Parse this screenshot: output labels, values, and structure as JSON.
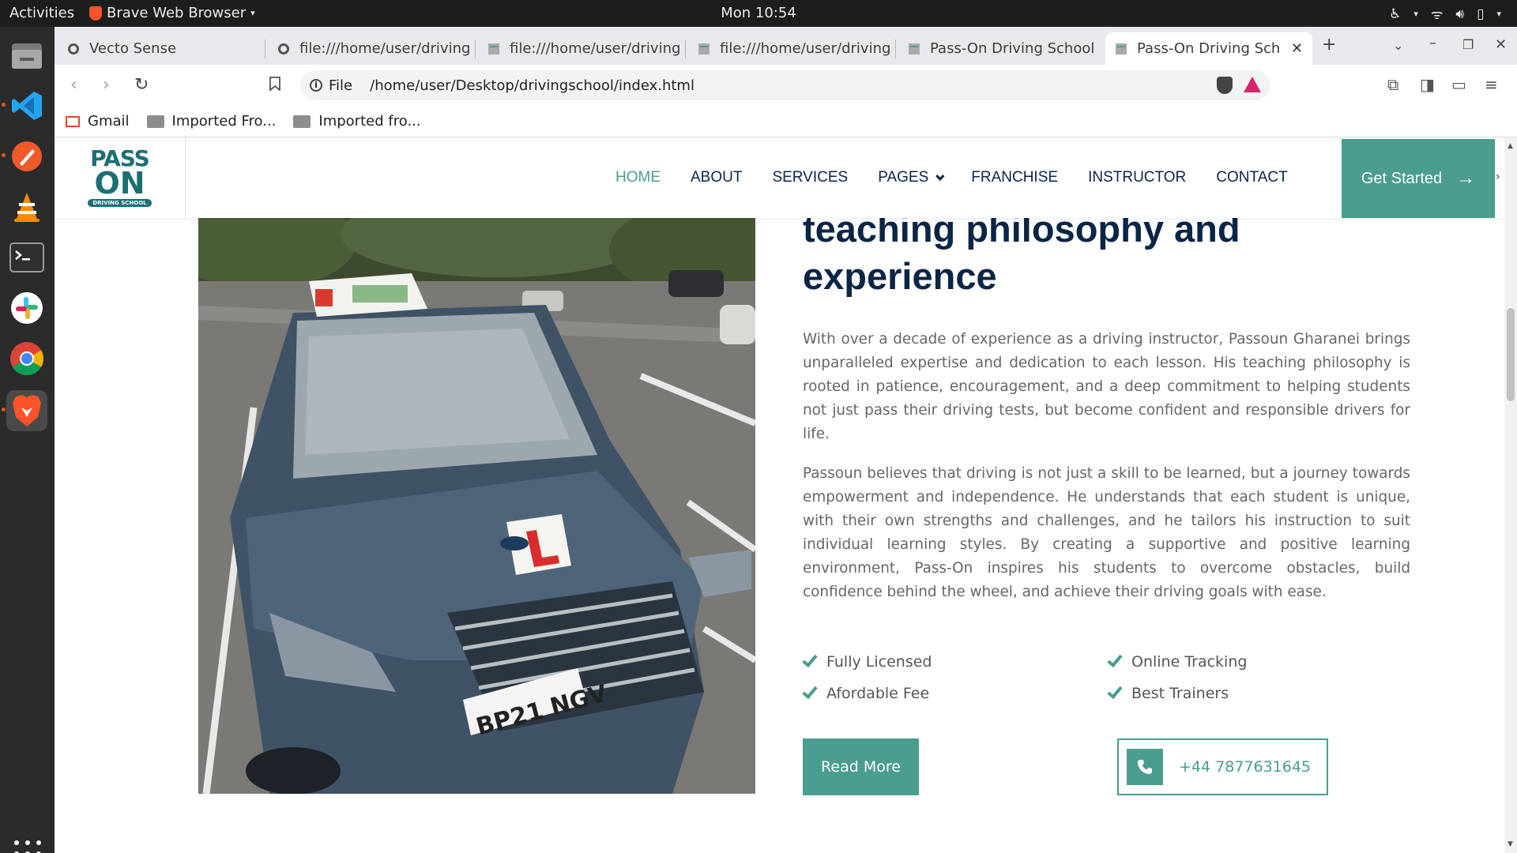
{
  "os": {
    "activities_label": "Activities",
    "app_menu_label": "Brave Web Browser",
    "clock": "Mon 10:54"
  },
  "browser": {
    "tabs": [
      {
        "title": "Vecto Sense"
      },
      {
        "title": "file:///home/user/driving"
      },
      {
        "title": "file:///home/user/driving"
      },
      {
        "title": "file:///home/user/driving"
      },
      {
        "title": "Pass-On Driving School"
      },
      {
        "title": "Pass-On Driving Scho"
      }
    ],
    "address": {
      "scheme_label": "File",
      "url": "/home/user/Desktop/drivingschool/index.html"
    },
    "bookmarks": [
      {
        "label": "Gmail"
      },
      {
        "label": "Imported Fro..."
      },
      {
        "label": "Imported fro..."
      }
    ]
  },
  "site": {
    "logo": {
      "line1": "PASS",
      "line2": "ON",
      "tag": "DRIVING SCHOOL"
    },
    "menu": [
      {
        "label": "HOME"
      },
      {
        "label": "ABOUT"
      },
      {
        "label": "SERVICES"
      },
      {
        "label": "PAGES"
      },
      {
        "label": "FRANCHISE"
      },
      {
        "label": "INSTRUCTOR"
      },
      {
        "label": "CONTACT"
      }
    ],
    "cta_label": "Get Started",
    "heading": "teaching philosophy and experience",
    "paragraphs": [
      "With over a decade of experience as a driving instructor, Passoun Gharanei brings unparalleled expertise and dedication to each lesson. His teaching philosophy is rooted in patience, encouragement, and a deep commitment to helping students not just pass their driving tests, but become confident and responsible drivers for life.",
      "Passoun believes that driving is not just a skill to be learned, but a journey towards empowerment and independence. He understands that each student is unique, with their own strengths and challenges, and he tailors his instruction to suit individual learning styles. By creating a supportive and positive learning environment, Pass-On inspires his students to overcome obstacles, build confidence behind the wheel, and achieve their driving goals with ease."
    ],
    "features": [
      {
        "label": "Fully Licensed"
      },
      {
        "label": "Online Tracking"
      },
      {
        "label": "Afordable Fee"
      },
      {
        "label": "Best Trainers"
      }
    ],
    "read_more_label": "Read More",
    "phone": "+44 7877631645",
    "photo": {
      "plate_text": "BP21 NGV"
    }
  },
  "colors": {
    "accent": "#4a9d8f",
    "heading": "#0b2545",
    "logo": "#1c6f75"
  }
}
